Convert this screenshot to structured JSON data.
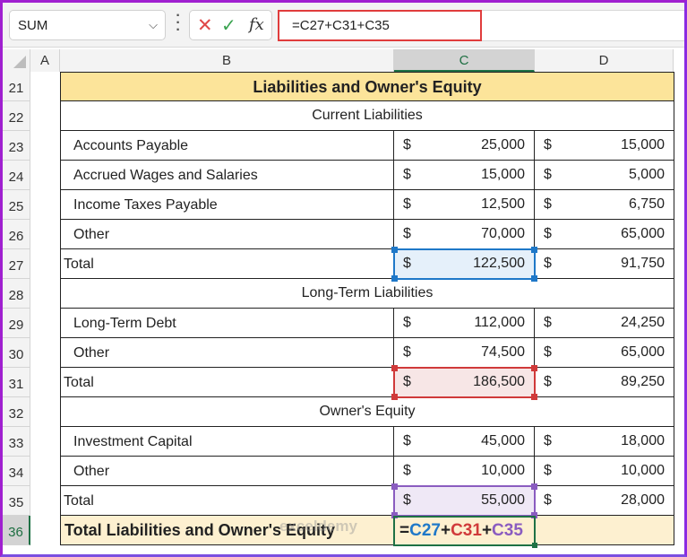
{
  "formula_bar": {
    "name_box": "SUM",
    "name_box_icon": "chevron-down-icon",
    "cancel_icon": "close-icon",
    "enter_icon": "check-icon",
    "fx_label": "fx",
    "formula": "=C27+C31+C35"
  },
  "columns": [
    "A",
    "B",
    "C",
    "D"
  ],
  "selected_column": "C",
  "rows": [
    "21",
    "22",
    "23",
    "24",
    "25",
    "26",
    "27",
    "28",
    "29",
    "30",
    "31",
    "32",
    "33",
    "34",
    "35",
    "36"
  ],
  "selected_row": "36",
  "sheet": {
    "title": "Liabilities and Owner's Equity",
    "sections": {
      "current": "Current Liabilities",
      "long_term": "Long-Term Liabilities",
      "equity": "Owner's Equity"
    },
    "currency": "$",
    "lines": [
      {
        "label": "Accounts Payable",
        "c": "25,000",
        "d": "15,000"
      },
      {
        "label": "Accrued Wages and Salaries",
        "c": "15,000",
        "d": "5,000"
      },
      {
        "label": "Income Taxes Payable",
        "c": "12,500",
        "d": "6,750"
      },
      {
        "label": "Other",
        "c": "70,000",
        "d": "65,000"
      },
      {
        "label": "Total",
        "c": "122,500",
        "d": "91,750"
      },
      {
        "label": "Long-Term Debt",
        "c": "112,000",
        "d": "24,250"
      },
      {
        "label": "Other",
        "c": "74,500",
        "d": "65,000"
      },
      {
        "label": "Total",
        "c": "186,500",
        "d": "89,250"
      },
      {
        "label": "Investment Capital",
        "c": "45,000",
        "d": "18,000"
      },
      {
        "label": "Other",
        "c": "10,000",
        "d": "10,000"
      },
      {
        "label": "Total",
        "c": "55,000",
        "d": "28,000"
      }
    ],
    "grand_total_label": "Total Liabilities and Owner's Equity",
    "grand_total_formula": {
      "eq": "=",
      "ref1": "C27",
      "plus1": "+",
      "ref2": "C31",
      "plus2": "+",
      "ref3": "C35"
    }
  },
  "watermark": "exceldemy",
  "colors": {
    "ref1": "#1f78c8",
    "ref2": "#d03a3a",
    "ref3": "#8a5cc0",
    "active_cell": "#1e7145",
    "title_fill": "#fce49a"
  }
}
